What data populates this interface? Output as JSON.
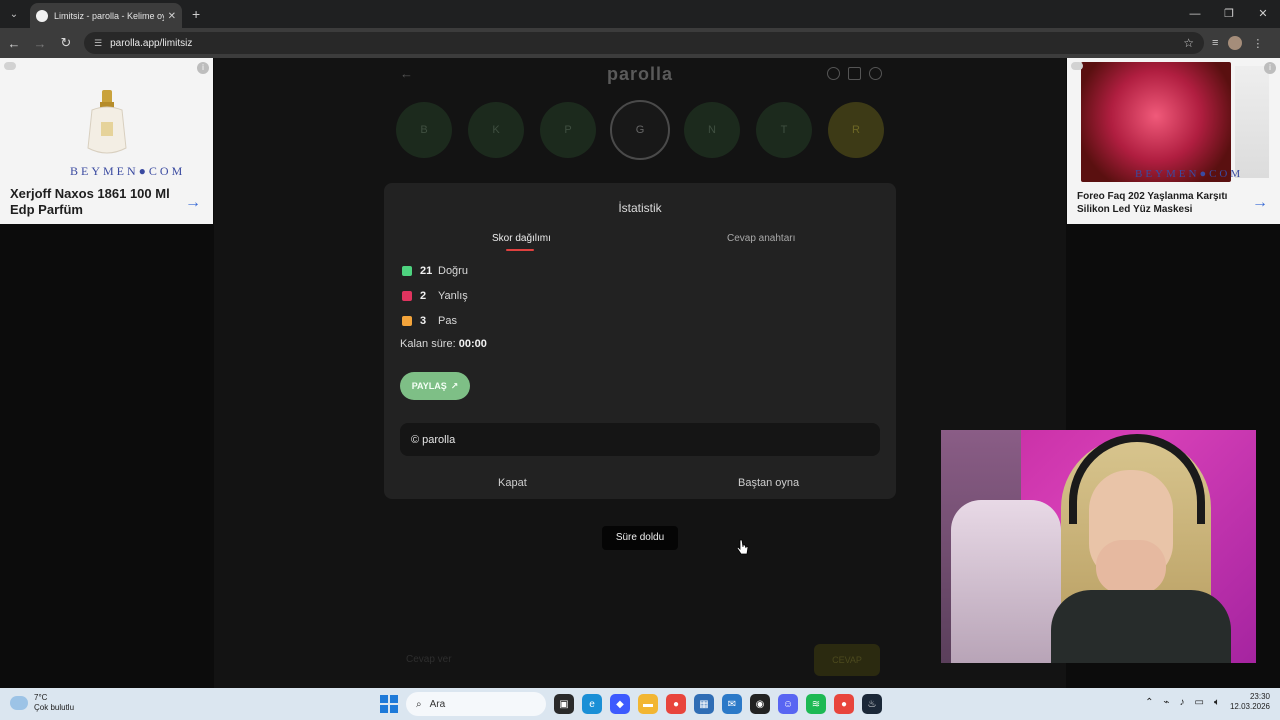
{
  "browser": {
    "tab_title": "Limitsiz - parolla - Kelime oyunu",
    "tab_close": "✕",
    "new_tab": "+",
    "url": "parolla.app/limitsiz",
    "window_controls": [
      "—",
      "❐",
      "✕"
    ]
  },
  "ads": {
    "left": {
      "brand": "BEYMEN●COM",
      "description": "Xerjoff Naxos 1861 100 Ml Edp Parfüm",
      "arrow": "→"
    },
    "right": {
      "brand": "BEYMEN●COM",
      "description": "Foreo Faq 202 Yaşlanma Karşıtı Silikon Led Yüz Maskesi",
      "arrow": "→"
    }
  },
  "game": {
    "logo": "parolla",
    "back": "←",
    "circles": [
      "B",
      "K",
      "P",
      "G",
      "N",
      "T",
      "R"
    ]
  },
  "modal": {
    "title": "İstatistik",
    "tabs": [
      "Skor dağılımı",
      "Cevap anahtarı"
    ],
    "stats": [
      {
        "count": "21",
        "label": "Doğru",
        "color": "#4ed37f"
      },
      {
        "count": "2",
        "label": "Yanlış",
        "color": "#e0345f"
      },
      {
        "count": "3",
        "label": "Pas",
        "color": "#f3a43b"
      }
    ],
    "remaining_label": "Kalan süre:",
    "remaining_value": "00:00",
    "share_label": "PAYLAŞ",
    "share_text": "© parolla",
    "close_label": "Kapat",
    "replay_label": "Baştan oyna"
  },
  "toast": "Süre doldu",
  "answer": {
    "placeholder": "Cevap ver",
    "button": "CEVAP"
  },
  "taskbar": {
    "temperature": "7°C",
    "weather": "Çok bulutlu",
    "search": "Ara",
    "time": "23:30",
    "date": "12.03.2026"
  }
}
